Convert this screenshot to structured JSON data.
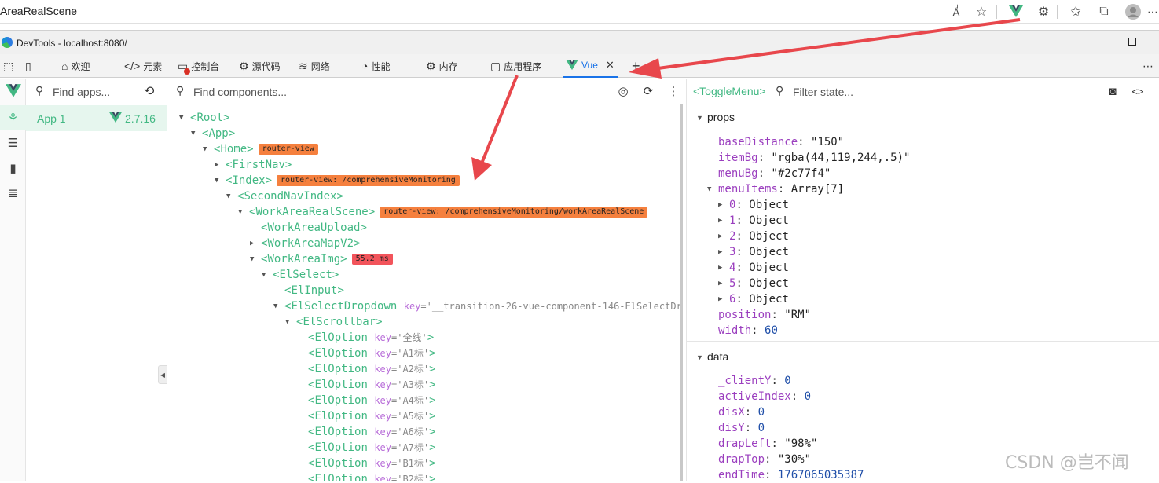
{
  "browser": {
    "title": "AreaRealScene",
    "icons": [
      "read-aloud-icon",
      "favorite-star-icon",
      "vue-devtools-extension-icon",
      "extensions-icon",
      "favorites-icon",
      "collections-icon",
      "profile-icon"
    ]
  },
  "devtools_window": {
    "title": "DevTools - localhost:8080/"
  },
  "tabs": [
    {
      "label": "欢迎"
    },
    {
      "label": "元素"
    },
    {
      "label": "控制台"
    },
    {
      "label": "源代码"
    },
    {
      "label": "网络"
    },
    {
      "label": "性能"
    },
    {
      "label": "内存"
    },
    {
      "label": "应用程序"
    },
    {
      "label": "Vue"
    }
  ],
  "tabs_extra": {
    "add": "+",
    "close": "✕",
    "more": "⋯"
  },
  "apps": {
    "search_placeholder": "Find apps...",
    "items": [
      {
        "name": "App 1",
        "version": "2.7.16"
      }
    ]
  },
  "components": {
    "search_placeholder": "Find components...",
    "tree": [
      {
        "depth": 0,
        "arrow": "open",
        "name": "Root"
      },
      {
        "depth": 1,
        "arrow": "open",
        "name": "App"
      },
      {
        "depth": 2,
        "arrow": "open",
        "name": "Home",
        "badge": "router-view",
        "badge_color": "orange"
      },
      {
        "depth": 3,
        "arrow": "closed",
        "name": "FirstNav"
      },
      {
        "depth": 3,
        "arrow": "open",
        "name": "Index",
        "badge": "router-view: /comprehensiveMonitoring",
        "badge_color": "orange"
      },
      {
        "depth": 4,
        "arrow": "open",
        "name": "SecondNavIndex"
      },
      {
        "depth": 5,
        "arrow": "open",
        "name": "WorkAreaRealScene",
        "badge": "router-view: /comprehensiveMonitoring/workAreaRealScene",
        "badge_color": "orange"
      },
      {
        "depth": 6,
        "arrow": "none",
        "name": "WorkAreaUpload"
      },
      {
        "depth": 6,
        "arrow": "closed",
        "name": "WorkAreaMapV2"
      },
      {
        "depth": 6,
        "arrow": "open",
        "name": "WorkAreaImg",
        "badge": "55.2 ms",
        "badge_color": "red"
      },
      {
        "depth": 7,
        "arrow": "open",
        "name": "ElSelect"
      },
      {
        "depth": 8,
        "arrow": "none",
        "name": "ElInput"
      },
      {
        "depth": 8,
        "arrow": "open",
        "name": "ElSelectDropdown",
        "key": "'__transition-26-vue-component-146-ElSelectDr"
      },
      {
        "depth": 9,
        "arrow": "open",
        "name": "ElScrollbar"
      },
      {
        "depth": 10,
        "arrow": "none",
        "name": "ElOption",
        "key": "'全线'"
      },
      {
        "depth": 10,
        "arrow": "none",
        "name": "ElOption",
        "key": "'A1标'"
      },
      {
        "depth": 10,
        "arrow": "none",
        "name": "ElOption",
        "key": "'A2标'"
      },
      {
        "depth": 10,
        "arrow": "none",
        "name": "ElOption",
        "key": "'A3标'"
      },
      {
        "depth": 10,
        "arrow": "none",
        "name": "ElOption",
        "key": "'A4标'"
      },
      {
        "depth": 10,
        "arrow": "none",
        "name": "ElOption",
        "key": "'A5标'"
      },
      {
        "depth": 10,
        "arrow": "none",
        "name": "ElOption",
        "key": "'A6标'"
      },
      {
        "depth": 10,
        "arrow": "none",
        "name": "ElOption",
        "key": "'A7标'"
      },
      {
        "depth": 10,
        "arrow": "none",
        "name": "ElOption",
        "key": "'B1标'"
      },
      {
        "depth": 10,
        "arrow": "none",
        "name": "ElOption",
        "key": "'B2标'"
      }
    ]
  },
  "state": {
    "selected_component": "<ToggleMenu>",
    "filter_placeholder": "Filter state...",
    "props_label": "props",
    "props": [
      {
        "indent": 0,
        "arrow": "none",
        "key": "baseDistance",
        "value": "\"150\"",
        "kind": "str"
      },
      {
        "indent": 0,
        "arrow": "none",
        "key": "itemBg",
        "value": "\"rgba(44,119,244,.5)\"",
        "kind": "str"
      },
      {
        "indent": 0,
        "arrow": "none",
        "key": "menuBg",
        "value": "\"#2c77f4\"",
        "kind": "str"
      },
      {
        "indent": -1,
        "arrow": "open",
        "key": "menuItems",
        "value": "Array[7]",
        "kind": "type"
      },
      {
        "indent": 1,
        "arrow": "closed",
        "key": "0",
        "value": "Object",
        "kind": "type"
      },
      {
        "indent": 1,
        "arrow": "closed",
        "key": "1",
        "value": "Object",
        "kind": "type"
      },
      {
        "indent": 1,
        "arrow": "closed",
        "key": "2",
        "value": "Object",
        "kind": "type"
      },
      {
        "indent": 1,
        "arrow": "closed",
        "key": "3",
        "value": "Object",
        "kind": "type"
      },
      {
        "indent": 1,
        "arrow": "closed",
        "key": "4",
        "value": "Object",
        "kind": "type"
      },
      {
        "indent": 1,
        "arrow": "closed",
        "key": "5",
        "value": "Object",
        "kind": "type"
      },
      {
        "indent": 1,
        "arrow": "closed",
        "key": "6",
        "value": "Object",
        "kind": "type"
      },
      {
        "indent": 0,
        "arrow": "none",
        "key": "position",
        "value": "\"RM\"",
        "kind": "str"
      },
      {
        "indent": 0,
        "arrow": "none",
        "key": "width",
        "value": "60",
        "kind": "num"
      }
    ],
    "data_label": "data",
    "data": [
      {
        "key": "_clientY",
        "value": "0",
        "kind": "num"
      },
      {
        "key": "activeIndex",
        "value": "0",
        "kind": "num"
      },
      {
        "key": "disX",
        "value": "0",
        "kind": "num"
      },
      {
        "key": "disY",
        "value": "0",
        "kind": "num"
      },
      {
        "key": "drapLeft",
        "value": "\"98%\"",
        "kind": "str"
      },
      {
        "key": "drapTop",
        "value": "\"30%\"",
        "kind": "str"
      },
      {
        "key": "endTime",
        "value": "1767065035387",
        "kind": "num"
      }
    ]
  },
  "watermark": "CSDN @岂不闻",
  "colors": {
    "vue_green": "#42b883",
    "badge_orange": "#f5803e",
    "badge_red": "#f2545b",
    "arrow_red": "#e8474c",
    "prop_key": "#9b3fbf",
    "number": "#1f4ea8"
  }
}
